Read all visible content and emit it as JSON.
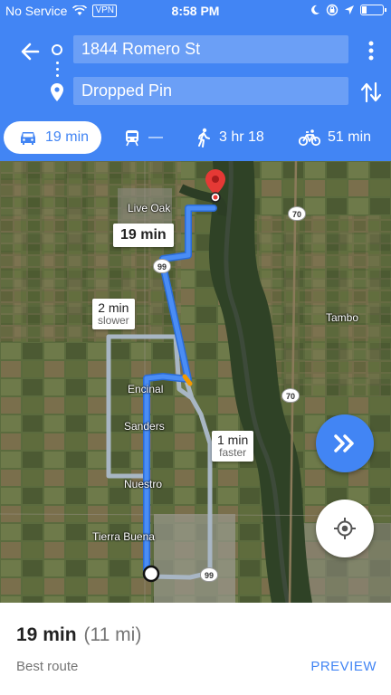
{
  "status_bar": {
    "carrier": "No Service",
    "vpn": "VPN",
    "time": "8:58 PM"
  },
  "header": {
    "origin": "1844 Romero St",
    "destination": "Dropped Pin"
  },
  "modes": [
    {
      "name": "drive",
      "label": "19 min",
      "icon": "car-icon",
      "selected": true
    },
    {
      "name": "transit",
      "label": "—",
      "icon": "train-icon",
      "selected": false
    },
    {
      "name": "walk",
      "label": "3 hr 18",
      "icon": "walking-icon",
      "selected": false
    },
    {
      "name": "bike",
      "label": "51 min",
      "icon": "bicycle-icon",
      "selected": false
    }
  ],
  "map": {
    "place_labels": [
      "Live Oak",
      "Tambo",
      "Encinal",
      "Sanders",
      "Nuestro",
      "Tierra Buena"
    ],
    "highway_shields": [
      "70",
      "99",
      "70",
      "99"
    ],
    "callouts": {
      "main": {
        "time": "19 min"
      },
      "alt1": {
        "time": "2 min",
        "note": "slower"
      },
      "alt2": {
        "time": "1 min",
        "note": "faster"
      }
    }
  },
  "sheet": {
    "duration": "19 min",
    "distance": "(11 mi)",
    "summary": "Best route",
    "action": "PREVIEW"
  },
  "colors": {
    "primary": "#4285f4",
    "route_main": "#4a8df5",
    "route_alt": "#a8b6c4",
    "pin": "#e53935"
  }
}
